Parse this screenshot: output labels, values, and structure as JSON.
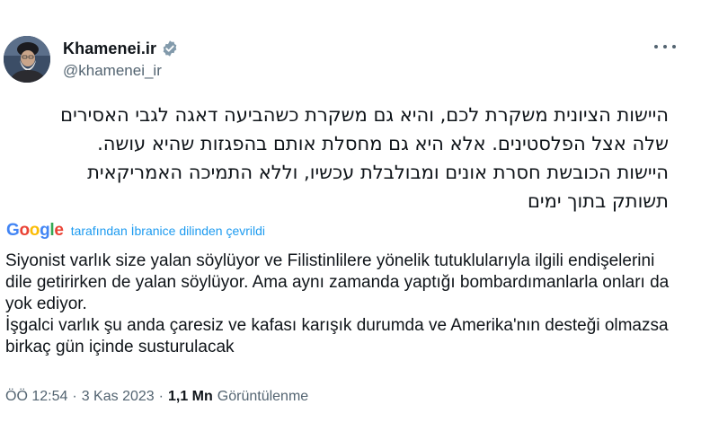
{
  "author": {
    "display_name": "Khamenei.ir",
    "handle": "@khamenei_ir",
    "verified_icon": "verified-badge-icon",
    "avatar_icon": "avatar-icon"
  },
  "menu": {
    "more_icon": "more-options-icon"
  },
  "tweet": {
    "hebrew_lines": [
      "היישות הציונית משקרת לכם, והיא גם משקרת כשהביעה דאגה לגבי האסירים",
      "שלה אצל הפלסטינים. אלא היא גם מחסלת אותם בהפגזות שהיא עושה.",
      "היישות הכובשת חסרת אונים ומבולבלת עכשיו, וללא התמיכה האמריקאית",
      "תשותק בתוך ימים"
    ]
  },
  "translation": {
    "google_letters": [
      "G",
      "o",
      "o",
      "g",
      "l",
      "e"
    ],
    "translated_by": "tarafından İbranice dilinden çevrildi",
    "paragraph_1": "Siyonist varlık size yalan söylüyor ve Filistinlilere yönelik tutuklularıyla ilgili endişelerini dile getirirken de yalan söylüyor. Ama aynı zamanda yaptığı bombardımanlarla onları da yok ediyor.",
    "paragraph_2": "İşgalci varlık şu anda çaresiz ve kafası karışık durumda ve Amerika'nın desteği olmazsa birkaç gün içinde susturulacak"
  },
  "meta": {
    "time": "ÖÖ 12:54",
    "dot": "·",
    "date": "3 Kas 2023",
    "views_count": "1,1 Mn",
    "views_label": "Görüntülenme"
  },
  "colors": {
    "accent": "#1d9bf0",
    "secondary_text": "#536471",
    "primary_text": "#0f1419"
  }
}
